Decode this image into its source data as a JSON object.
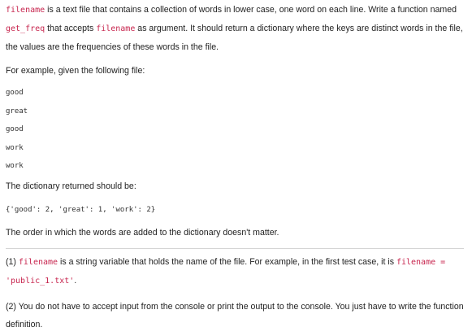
{
  "intro": {
    "code1": "filename",
    "text1": " is a text file that contains a collection of words in lower case, one word on each line. Write a function named ",
    "code2": "get_freq",
    "text2": " that accepts ",
    "code3": "filename",
    "text3": " as argument. It should return a dictionary where the keys are distinct words in the file, the values are the frequencies of these words in the file."
  },
  "example_intro": "For example, given the following file:",
  "file_lines": [
    "good",
    "great",
    "good",
    "work",
    "work"
  ],
  "returned_label": "The dictionary returned should be:",
  "dict_output": "{'good': 2, 'great': 1, 'work': 2}",
  "order_note": "The order in which the words are added to the dictionary doesn't matter.",
  "note1": {
    "text1": "(1) ",
    "code1": "filename",
    "text2": " is a string variable that holds the name of the file. For example, in the first test case, it is ",
    "code2": "filename = 'public_1.txt'",
    "text3": "."
  },
  "note2": "(2) You do not have to accept input from the console or print the output to the console. You just have to write the function definition."
}
